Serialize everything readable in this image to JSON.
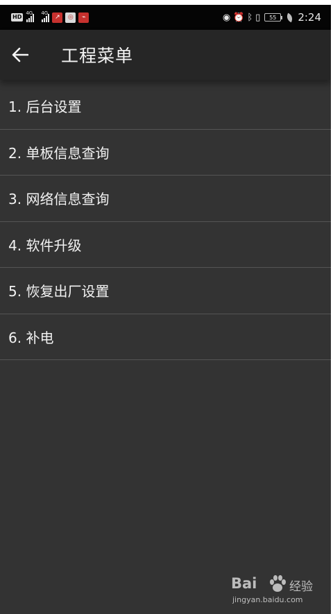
{
  "status_bar": {
    "hd_badge": "HD",
    "network_type_1": "4G",
    "network_type_2": "4G",
    "battery_level": "55",
    "time": "2:24",
    "icons": [
      "hd-icon",
      "signal-icon",
      "signal-icon",
      "stock-app-icon",
      "alert-app-icon",
      "chart-app-icon",
      "eye-icon",
      "alarm-icon",
      "bluetooth-icon",
      "vibrate-icon",
      "battery-icon",
      "leaf-icon"
    ]
  },
  "toolbar": {
    "back_icon": "arrow-left-icon",
    "title": "工程菜单"
  },
  "menu": {
    "items": [
      {
        "label": "1. 后台设置"
      },
      {
        "label": "2. 单板信息查询"
      },
      {
        "label": "3. 网络信息查询"
      },
      {
        "label": "4. 软件升级"
      },
      {
        "label": "5. 恢复出厂设置"
      },
      {
        "label": "6. 补电"
      }
    ]
  },
  "watermark": {
    "brand": "Bai",
    "brand_cn": "经验",
    "url": "jingyan.baidu.com"
  },
  "colors": {
    "background": "#333333",
    "toolbar": "#262626",
    "status_bar": "#050505",
    "divider": "#555555",
    "text": "#f2f2f2"
  }
}
